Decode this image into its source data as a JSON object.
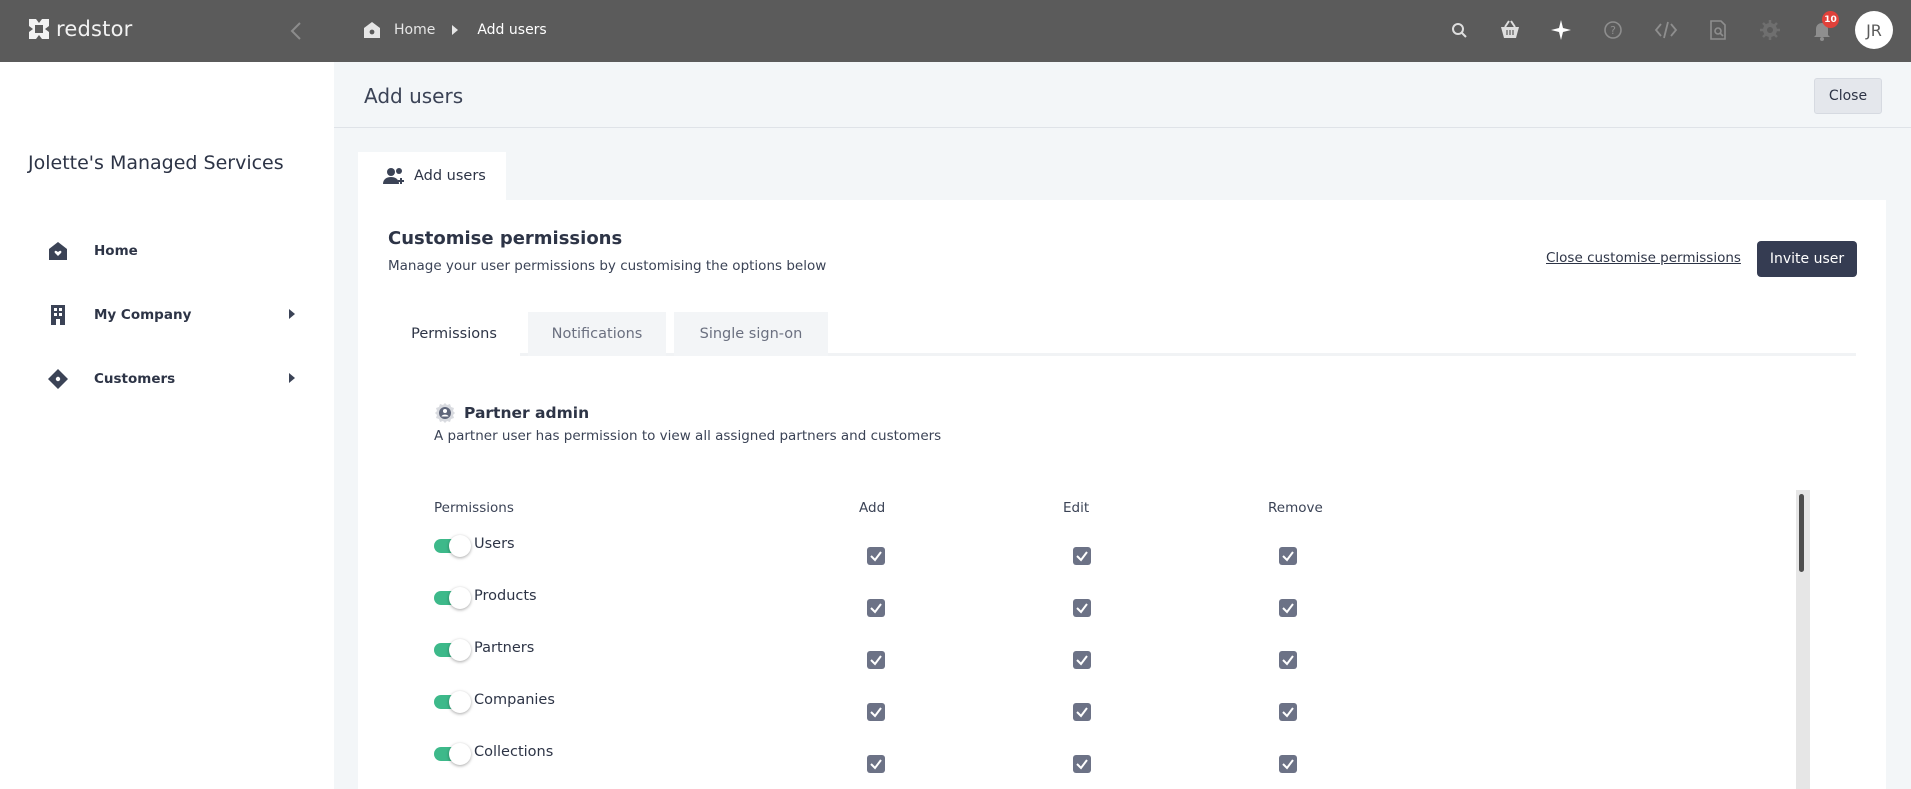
{
  "topbar": {
    "logo_text": "redstor",
    "breadcrumb": {
      "home": "Home",
      "current": "Add users"
    },
    "icons": [
      "search-icon",
      "basket-icon",
      "sparkle-icon",
      "help-icon",
      "code-icon",
      "document-search-icon",
      "settings-icon",
      "bell-icon"
    ],
    "notification_count": "10",
    "user_initials": "JR"
  },
  "sidebar": {
    "org_name": "Jolette's Managed Services",
    "items": [
      {
        "label": "Home",
        "icon": "home-icon",
        "has_submenu": false
      },
      {
        "label": "My Company",
        "icon": "building-icon",
        "has_submenu": true
      },
      {
        "label": "Customers",
        "icon": "customers-icon",
        "has_submenu": true
      }
    ]
  },
  "page": {
    "title": "Add users",
    "close_label": "Close",
    "outer_tab_label": "Add users"
  },
  "customise": {
    "title": "Customise permissions",
    "subtitle": "Manage your user permissions by customising the options below",
    "close_link": "Close customise permissions",
    "invite_label": "Invite user",
    "tabs": [
      "Permissions",
      "Notifications",
      "Single sign-on"
    ],
    "active_tab": "Permissions"
  },
  "role": {
    "name": "Partner admin",
    "description": "A partner user has permission to view all assigned partners and customers"
  },
  "permissions_table": {
    "headers": [
      "Permissions",
      "Add",
      "Edit",
      "Remove"
    ],
    "rows": [
      {
        "name": "Users",
        "enabled": true,
        "add": true,
        "edit": true,
        "remove": true
      },
      {
        "name": "Products",
        "enabled": true,
        "add": true,
        "edit": true,
        "remove": true
      },
      {
        "name": "Partners",
        "enabled": true,
        "add": true,
        "edit": true,
        "remove": true
      },
      {
        "name": "Companies",
        "enabled": true,
        "add": true,
        "edit": true,
        "remove": true
      },
      {
        "name": "Collections",
        "enabled": true,
        "add": true,
        "edit": true,
        "remove": true
      }
    ]
  },
  "colors": {
    "topbar": "#5b5b5b",
    "toggle_on": "#3db98a",
    "checkbox": "#6c7286",
    "primary_button": "#353c52",
    "badge": "#e0413a"
  }
}
